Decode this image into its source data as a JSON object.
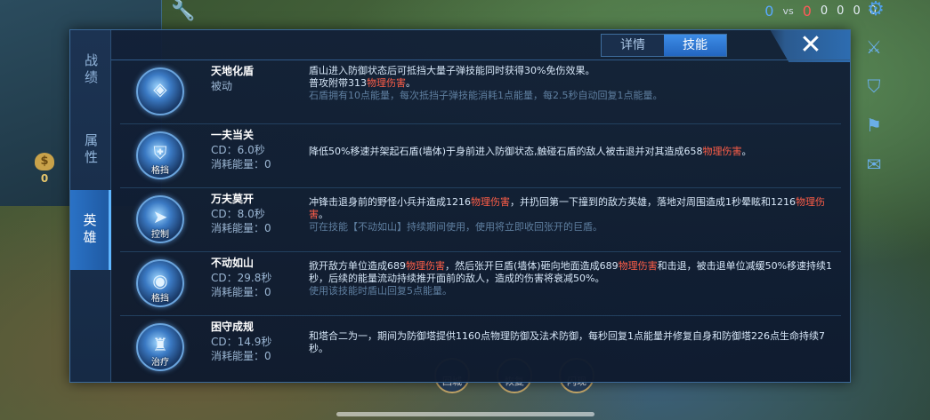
{
  "hud": {
    "score_blue": "0",
    "vs": "vs",
    "score_red": "0",
    "stats": [
      "0",
      "0",
      "0",
      "0"
    ],
    "gold": "0",
    "bottom_buttons": [
      "回城",
      "恢复",
      "闪现"
    ]
  },
  "side_nav": [
    {
      "label": "战绩",
      "active": false
    },
    {
      "label": "属性",
      "active": false
    },
    {
      "label": "英雄",
      "active": true
    }
  ],
  "tabs": [
    {
      "label": "详情",
      "active": false
    },
    {
      "label": "技能",
      "active": true
    }
  ],
  "close_label": "✕",
  "skills": [
    {
      "name": "天地化盾",
      "sub1": "被动",
      "sub2": "",
      "tag": "",
      "desc_1": "盾山进入防御状态后可抵挡大量子弹技能同时获得30%免伤效果。",
      "desc_2": "普攻附带313",
      "desc_red1": "物理伤害",
      "desc_3": "。",
      "desc_red2": "",
      "desc_4": "",
      "note": "石盾拥有10点能量，每次抵挡子弹技能消耗1点能量，每2.5秒自动回复1点能量。"
    },
    {
      "name": "一夫当关",
      "sub1": "CD：6.0秒",
      "sub2": "消耗能量：0",
      "tag": "格挡",
      "desc_1": "",
      "desc_2": "降低50%移速并架起石盾(墙体)于身前进入防御状态,触碰石盾的敌人被击退并对其造成658",
      "desc_red1": "物理伤害",
      "desc_3": "。",
      "desc_red2": "",
      "desc_4": "",
      "note": ""
    },
    {
      "name": "万夫莫开",
      "sub1": "CD：8.0秒",
      "sub2": "消耗能量：0",
      "tag": "控制",
      "desc_1": "",
      "desc_2": "冲锋击退身前的野怪小兵并造成1216",
      "desc_red1": "物理伤害",
      "desc_3": "，并扔回第一下撞到的敌方英雄，落地对周围造成1秒晕眩和1216",
      "desc_red2": "物理伤害",
      "desc_4": "。",
      "note": "可在技能【不动如山】持续期间使用，使用将立即收回张开的巨盾。"
    },
    {
      "name": "不动如山",
      "sub1": "CD：29.8秒",
      "sub2": "消耗能量：0",
      "tag": "格挡",
      "desc_1": "",
      "desc_2": "掀开敌方单位造成689",
      "desc_red1": "物理伤害",
      "desc_3": "，然后张开巨盾(墙体)砸向地面造成689",
      "desc_red2": "物理伤害",
      "desc_4": "和击退，被击退单位减缓50%移速持续1秒，后续的能量流动持续推开面前的敌人，造成的伤害将衰减50%。",
      "note": "使用该技能时盾山回复5点能量。"
    },
    {
      "name": "困守成规",
      "sub1": "CD：14.9秒",
      "sub2": "消耗能量：0",
      "tag": "治疗",
      "desc_1": "",
      "desc_2": "和塔合二为一，期间为防御塔提供1160点物理防御及法术防御，每秒回复1点能量并修复自身和防御塔226点生命持续7秒。",
      "desc_red1": "",
      "desc_3": "",
      "desc_red2": "",
      "desc_4": "",
      "note": ""
    }
  ],
  "icons": {
    "close": "close-icon",
    "settings": "gear-icon",
    "wrench": "wrench-icon",
    "sword": "sword-icon",
    "shield": "shield-icon",
    "flag": "flag-icon",
    "chat": "chat-icon",
    "gold": "money-bag-icon"
  },
  "colors": {
    "accent_blue": "#2a72c6",
    "damage_red": "#ff5e48",
    "panel_bg": "#122037"
  }
}
